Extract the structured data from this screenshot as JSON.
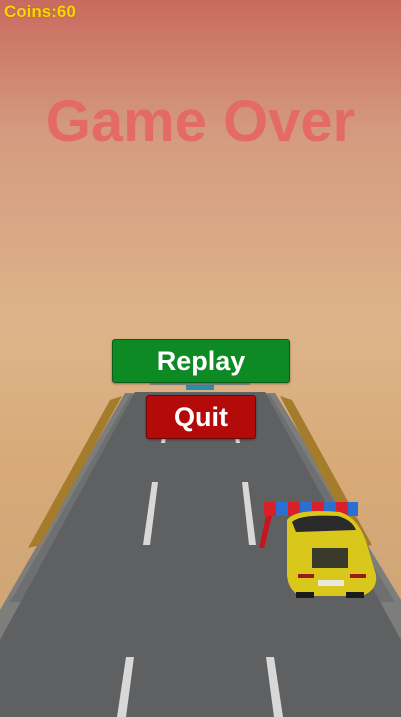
{
  "hud": {
    "coins_label": "Coins:60"
  },
  "overlay": {
    "title": "Game Over"
  },
  "buttons": {
    "replay_label": "Replay",
    "quit_label": "Quit"
  },
  "icons": [
    "road-scene",
    "player-car-icon",
    "barrier-icon"
  ],
  "colors": {
    "coins_text": "#ffd400",
    "title_text": "#e46a66",
    "replay_button": "#0e8a24",
    "quit_button": "#b30a0a"
  }
}
